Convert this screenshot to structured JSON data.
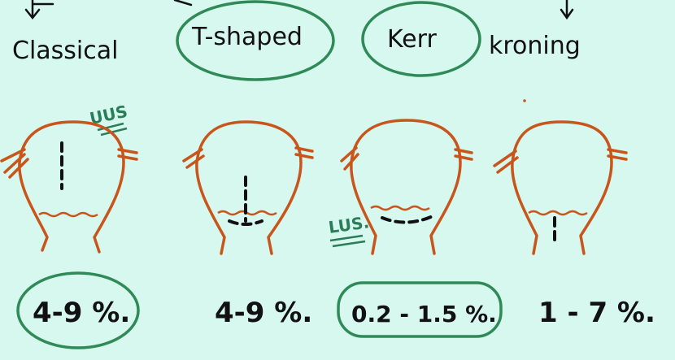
{
  "incisions": [
    {
      "name": "Classical",
      "rate": "4-9 %.",
      "circled_name": false,
      "circled_rate": true,
      "annotation": "UUS"
    },
    {
      "name": "T-shaped",
      "rate": "4-9 %.",
      "circled_name": true,
      "circled_rate": false,
      "annotation": ""
    },
    {
      "name": "Kerr",
      "rate": "0.2 - 1.5 %.",
      "circled_name": true,
      "circled_rate": true,
      "annotation": "LUS."
    },
    {
      "name": "kroning",
      "rate": "1 - 7 %.",
      "circled_name": false,
      "circled_rate": false,
      "annotation": ""
    }
  ],
  "colors": {
    "background": "#d7f8ee",
    "uterus": "#c8561c",
    "circle": "#2f8a57",
    "ink": "#111111",
    "annotation": "#2b7d5a"
  }
}
